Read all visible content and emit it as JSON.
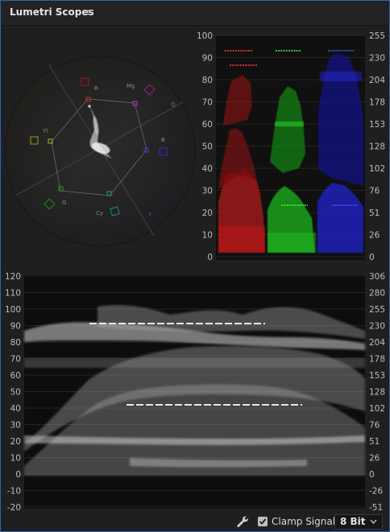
{
  "panel": {
    "title": "Lumetri Scopes"
  },
  "vectorscope": {
    "targets": [
      "R",
      "Mg",
      "B",
      "Cy",
      "G",
      "Yl"
    ],
    "axes": [
      "Q",
      "I"
    ]
  },
  "parade": {
    "left_ticks": [
      "100",
      "90",
      "80",
      "70",
      "60",
      "50",
      "40",
      "30",
      "20",
      "10",
      "0"
    ],
    "right_ticks": [
      "255",
      "230",
      "204",
      "178",
      "153",
      "128",
      "102",
      "76",
      "51",
      "26",
      "0"
    ]
  },
  "waveform": {
    "left_ticks": [
      "120",
      "110",
      "100",
      "90",
      "80",
      "70",
      "60",
      "50",
      "40",
      "30",
      "20",
      "10",
      "0",
      "-10",
      "-20"
    ],
    "right_ticks": [
      "306",
      "280",
      "255",
      "230",
      "204",
      "178",
      "153",
      "128",
      "102",
      "76",
      "51",
      "26",
      "0",
      "-26",
      "-51"
    ]
  },
  "footer": {
    "clamp_label": "Clamp Signal",
    "clamp_checked": true,
    "bit_depth": "8 Bit"
  }
}
